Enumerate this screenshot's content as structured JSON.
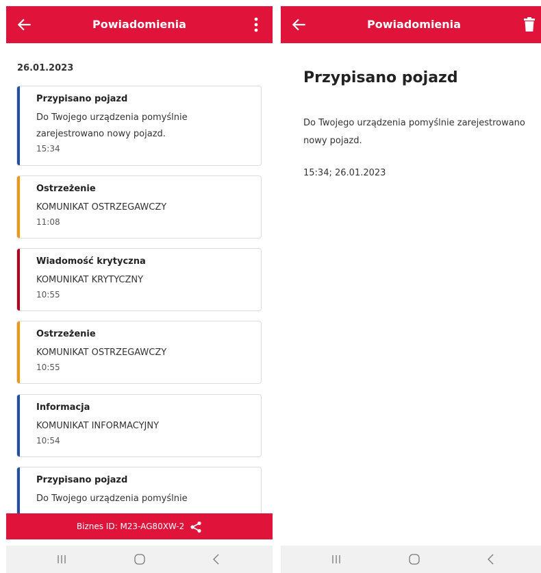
{
  "left_screen": {
    "header": {
      "title": "Powiadomienia",
      "back_icon": "arrow-left-icon",
      "menu_icon": "kebab-menu-icon"
    },
    "date_group": "26.01.2023",
    "notifications": [
      {
        "title": "Przypisano pojazd",
        "body": "Do Twojego urządzenia pomyślnie zarejestrowano nowy pojazd.",
        "time": "15:34",
        "color": "#1f4fa6"
      },
      {
        "title": "Ostrzeżenie",
        "body": "KOMUNIKAT OSTRZEGAWCZY",
        "time": "11:08",
        "color": "#f0960d"
      },
      {
        "title": "Wiadomość krytyczna",
        "body": "KOMUNIKAT KRYTYCZNY",
        "time": "10:55",
        "color": "#b3001b"
      },
      {
        "title": "Ostrzeżenie",
        "body": "KOMUNIKAT OSTRZEGAWCZY",
        "time": "10:55",
        "color": "#f0960d"
      },
      {
        "title": "Informacja",
        "body": "KOMUNIKAT INFORMACYJNY",
        "time": "10:54",
        "color": "#1f4fa6"
      },
      {
        "title": "Przypisano pojazd",
        "body": "Do Twojego urządzenia pomyślnie",
        "time": "",
        "color": "#1f4fa6"
      }
    ],
    "footer": {
      "business_id": "Biznes ID:  M23-AG80XW-2",
      "share_icon": "share-icon"
    }
  },
  "right_screen": {
    "header": {
      "title": "Powiadomienia",
      "back_icon": "arrow-left-icon",
      "delete_icon": "trash-icon"
    },
    "detail": {
      "title": "Przypisano pojazd",
      "body": "Do Twojego urządzenia pomyślnie zarejestrowano nowy pojazd.",
      "timestamp": "15:34; 26.01.2023"
    }
  },
  "system_nav": {
    "icons": [
      "recent-apps-icon",
      "home-icon",
      "back-icon"
    ]
  },
  "colors": {
    "brand": "#e0143a",
    "info": "#1f4fa6",
    "warning": "#f0960d",
    "critical": "#b3001b"
  }
}
